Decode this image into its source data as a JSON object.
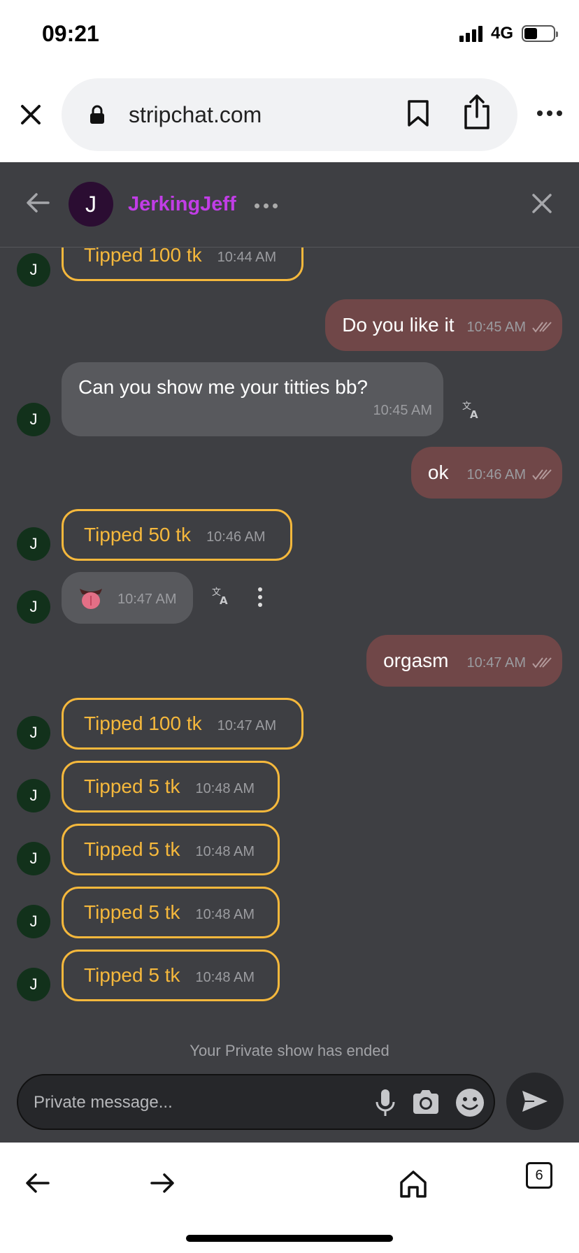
{
  "status_bar": {
    "time": "09:21",
    "network": "4G",
    "battery_level": 0.45
  },
  "browser": {
    "url": "stripchat.com",
    "tab_count": "6"
  },
  "chat": {
    "username": "JerkingJeff",
    "avatar_initial": "J",
    "messages": [
      {
        "kind": "tip",
        "text": "Tipped 100 tk",
        "time": "10:44 AM"
      },
      {
        "kind": "outgoing",
        "text": "Do you like it",
        "time": "10:45 AM"
      },
      {
        "kind": "incoming",
        "text": "Can you show me your titties bb?",
        "time": "10:45 AM"
      },
      {
        "kind": "outgoing",
        "text": "ok",
        "time": "10:46 AM"
      },
      {
        "kind": "tip",
        "text": "Tipped 50 tk",
        "time": "10:46 AM"
      },
      {
        "kind": "incoming",
        "text": "",
        "time": "10:47 AM",
        "sticker": "tongue-emoji"
      },
      {
        "kind": "outgoing",
        "text": "orgasm",
        "time": "10:47 AM"
      },
      {
        "kind": "tip",
        "text": "Tipped 100 tk",
        "time": "10:47 AM"
      },
      {
        "kind": "tip",
        "text": "Tipped 5 tk",
        "time": "10:48 AM"
      },
      {
        "kind": "tip",
        "text": "Tipped 5 tk",
        "time": "10:48 AM"
      },
      {
        "kind": "tip",
        "text": "Tipped 5 tk",
        "time": "10:48 AM"
      },
      {
        "kind": "tip",
        "text": "Tipped 5 tk",
        "time": "10:48 AM"
      }
    ],
    "ended_notice": "Your Private show has ended",
    "composer_placeholder": "Private message..."
  },
  "colors": {
    "tip": "#f5b83c",
    "outgoing_bubble": "#704748",
    "incoming_bubble": "#58595d",
    "username": "#c13de6",
    "chat_bg": "#3e3f43"
  }
}
